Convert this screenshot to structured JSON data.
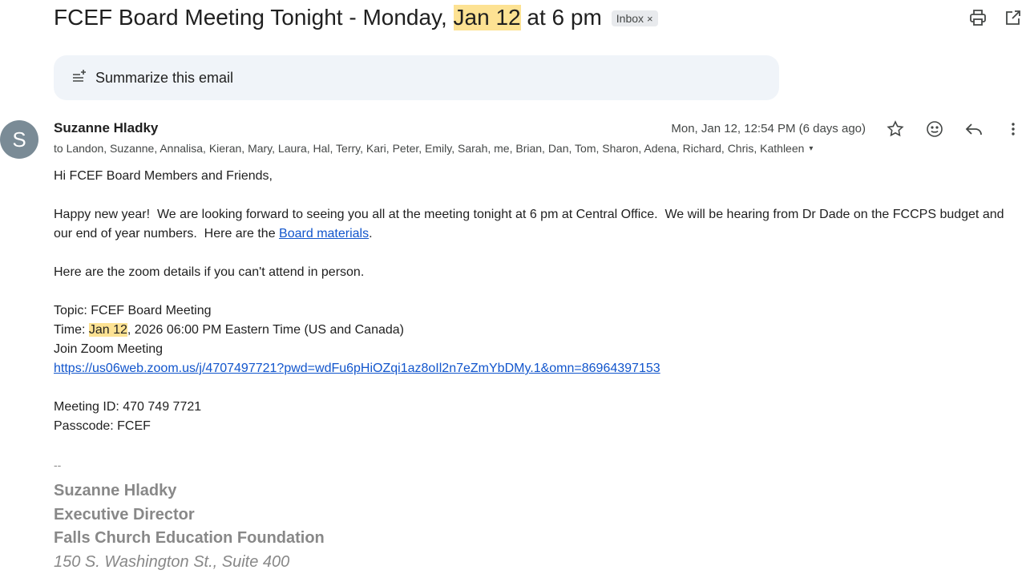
{
  "subject": {
    "before": "FCEF Board Meeting Tonight - Monday, ",
    "highlight": "Jan 12",
    "after": " at 6 pm",
    "label_chip": "Inbox",
    "label_remove": "×"
  },
  "icons": {
    "print": "print-icon",
    "popout": "open-in-new-window-icon",
    "summarize": "sparkle-lines-icon",
    "star": "star-icon",
    "emoji": "emoji-icon",
    "reply": "reply-icon",
    "more": "more-vert-icon",
    "expand": "caret-down-icon"
  },
  "summarize": {
    "label": "Summarize this email"
  },
  "message": {
    "avatar_letter": "S",
    "avatar_color": "#7a8b96",
    "sender": "Suzanne Hladky",
    "date": "Mon, Jan 12, 12:54 PM (6 days ago)",
    "recipients": "to Landon, Suzanne, Annalisa, Kieran, Mary, Laura, Hal, Terry, Kari, Peter, Emily, Sarah, me, Brian, Dan, Tom, Sharon, Adena, Richard, Chris, Kathleen",
    "expand_caret": "▾"
  },
  "body": {
    "greeting": "Hi FCEF Board Members and Friends,",
    "para1_text": "Happy new year!  We are looking forward to seeing you all at the meeting tonight at 6 pm at Central Office.  We will be hearing from Dr Dade on the FCCPS budget and our end of year numbers.  Here are the ",
    "para1_link": "Board materials",
    "para1_end": ".",
    "zoom_intro": "Here are the zoom details if you can't attend in person.",
    "topic": "Topic: FCEF Board Meeting",
    "time_prefix": "Time: ",
    "time_highlight": "Jan 12",
    "time_rest": ", 2026 06:00 PM Eastern Time (US and Canada)",
    "join": "Join Zoom Meeting",
    "zoom_link": "https://us06web.zoom.us/j/4707497721?pwd=wdFu6pHiOZqi1az8oIl2n7eZmYbDMy.1&omn=86964397153",
    "meeting_id": "Meeting ID: 470 749 7721",
    "passcode": "Passcode: FCEF"
  },
  "signature": {
    "dash": "--",
    "name": "Suzanne Hladky",
    "title": "Executive Director",
    "org": "Falls Church Education Foundation",
    "address": "150 S. Washington St., Suite 400"
  },
  "colors": {
    "highlight": "#fde293",
    "link": "#1155cc",
    "summarize_bg": "#f0f4f9"
  }
}
